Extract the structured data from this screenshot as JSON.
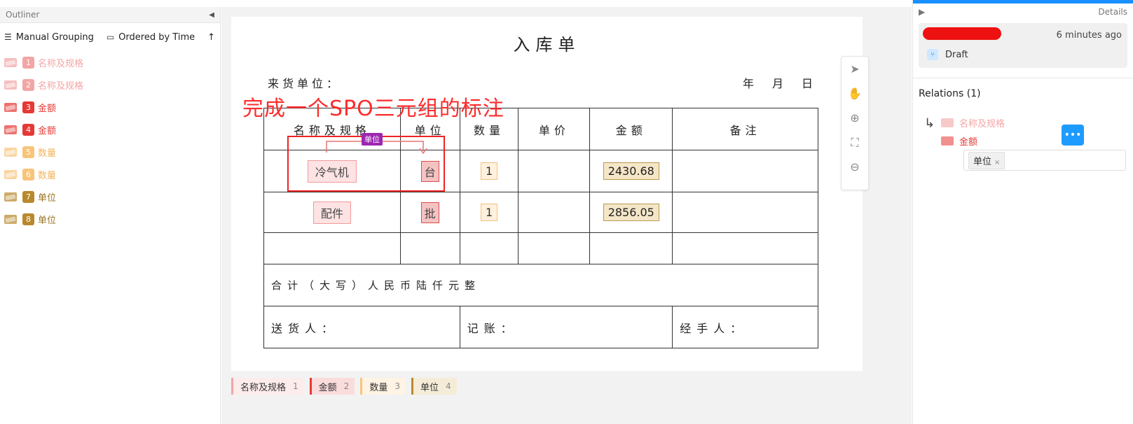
{
  "outliner": {
    "title": "Outliner",
    "collapse_icon": "◀",
    "grouping_label": "Manual Grouping",
    "ordering_label": "Ordered by Time",
    "sort_icon": "↑",
    "regions": [
      {
        "num": "1",
        "label": "名称及规格",
        "color": "#f3a5a5",
        "text_color": "#f3a5a5"
      },
      {
        "num": "2",
        "label": "名称及规格",
        "color": "#f3a5a5",
        "text_color": "#f3a5a5"
      },
      {
        "num": "3",
        "label": "金额",
        "color": "#e53935",
        "text_color": "#e53935"
      },
      {
        "num": "4",
        "label": "金额",
        "color": "#e53935",
        "text_color": "#e53935"
      },
      {
        "num": "5",
        "label": "数量",
        "color": "#f8c47a",
        "text_color": "#f5b55a"
      },
      {
        "num": "6",
        "label": "数量",
        "color": "#f8c47a",
        "text_color": "#f5b55a"
      },
      {
        "num": "7",
        "label": "单位",
        "color": "#b8892c",
        "text_color": "#9a7320"
      },
      {
        "num": "8",
        "label": "单位",
        "color": "#b8892c",
        "text_color": "#9a7320"
      }
    ]
  },
  "document": {
    "title": "入库单",
    "vendor_label": "来货单位：",
    "date_label": "年月日",
    "note": "完成一个SPO三元组的标注",
    "headers": [
      "名称及规格",
      "单位",
      "数量",
      "单价",
      "金额",
      "备注"
    ],
    "rows": [
      {
        "name": "冷气机",
        "unit": "台",
        "qty": "1",
        "price": "",
        "amount": "2430.68",
        "remark": ""
      },
      {
        "name": "配件",
        "unit": "批",
        "qty": "1",
        "price": "",
        "amount": "2856.05",
        "remark": ""
      }
    ],
    "total_label": "合计（大写）人民币陆仟元整",
    "deliverer_label": "送货人：",
    "bookkeeper_label": "记账：",
    "handler_label": "经手人：",
    "relation_tag": "单位"
  },
  "tools": [
    {
      "name": "pointer-icon",
      "glyph": "➤"
    },
    {
      "name": "hand-icon",
      "glyph": "✋"
    },
    {
      "name": "zoom-in-icon",
      "glyph": "⊕"
    },
    {
      "name": "fit-icon",
      "glyph": "⛶"
    },
    {
      "name": "zoom-out-icon",
      "glyph": "⊖"
    }
  ],
  "legend": [
    {
      "label": "名称及规格",
      "count": "1",
      "color": "#f3a5a5",
      "bg": "#fdecec"
    },
    {
      "label": "金额",
      "count": "2",
      "color": "#e53935",
      "bg": "#fbdcdc"
    },
    {
      "label": "数量",
      "count": "3",
      "color": "#f8c47a",
      "bg": "#fff3e3"
    },
    {
      "label": "单位",
      "count": "4",
      "color": "#b8892c",
      "bg": "#f5ecd8"
    }
  ],
  "details": {
    "title": "Details",
    "expand_icon": "▶",
    "time": "6 minutes ago",
    "status": "Draft",
    "relations_title": "Relations (1)",
    "relation_from": "名称及规格",
    "relation_to": "金额",
    "relation_label": "单位",
    "more_icon": "•••",
    "remove_icon": "×"
  }
}
